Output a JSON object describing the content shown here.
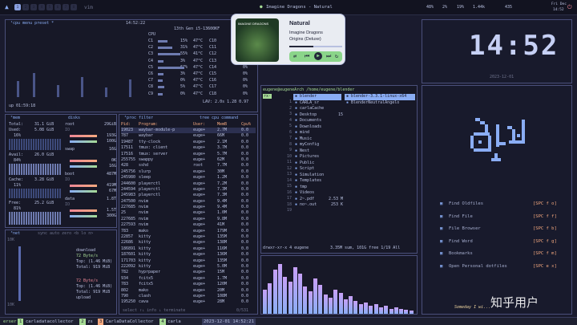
{
  "topbar": {
    "app": "vim",
    "media_title": "Imagine Dragons - Natural",
    "status": [
      "48%",
      "2%",
      "19%",
      "1.44k"
    ],
    "right": [
      "435",
      "Fri Dec",
      "14:52"
    ],
    "workspaces": [
      "1",
      "2",
      "3",
      "4",
      "5",
      "6",
      "7",
      "8"
    ]
  },
  "cpu": {
    "header": "¹cpu  menu  preset *",
    "time": "14:52:22",
    "model": "13th Gen i5-13600KF",
    "core_label": "CPU",
    "cores": [
      {
        "name": "C1",
        "pct": "15%",
        "temp": "47°C",
        "name2": "C10",
        "pct2": "0%"
      },
      {
        "name": "C2",
        "pct": "31%",
        "temp": "47°C",
        "name2": "C11",
        "pct2": "0%"
      },
      {
        "name": "C3",
        "pct": "55%",
        "temp": "41°C",
        "name2": "C12",
        "pct2": "0%"
      },
      {
        "name": "C4",
        "pct": "3%",
        "temp": "47°C",
        "name2": "C13",
        "pct2": "0%"
      },
      {
        "name": "C5",
        "pct": "67%",
        "temp": "47°C",
        "name2": "C14",
        "pct2": "0%"
      },
      {
        "name": "C6",
        "pct": "3%",
        "temp": "47°C",
        "name2": "C15",
        "pct2": "0%"
      },
      {
        "name": "C7",
        "pct": "0%",
        "temp": "47°C",
        "name2": "C16",
        "pct2": "0%"
      },
      {
        "name": "C8",
        "pct": "5%",
        "temp": "47°C",
        "name2": "C17",
        "pct2": "0%"
      },
      {
        "name": "C9",
        "pct": "0%",
        "temp": "47°C",
        "name2": "C18",
        "pct2": "0%"
      }
    ],
    "load": "LAV: 2.0s 1.28 0.97",
    "uptime": "up 01:59:18"
  },
  "mem": {
    "header": "²mem",
    "disks_header": "disks",
    "total_label": "Total:",
    "total": "31.1 GiB",
    "used_label": "Used:",
    "used": "5.08 GiB",
    "used_pct": "16%",
    "avail_label": "Avail:",
    "avail": "26.0 GiB",
    "avail_pct": "84%",
    "cache_label": "Cache:",
    "cache": "3.28 GiB",
    "cache_pct": "11%",
    "free_label": "Free:",
    "free": "25.2 GiB",
    "free_pct": "81%",
    "disks": [
      {
        "name": "root",
        "size": "29GiB",
        "io": "IO",
        "u": "193G",
        "f": "100G"
      },
      {
        "name": "swap",
        "size": "16G",
        "io": "",
        "u": "0K",
        "f": "16G"
      },
      {
        "name": "boot",
        "size": "487M",
        "io": "IO",
        "u": "419M",
        "f": "67M"
      },
      {
        "name": "data",
        "size": "1.8T",
        "io": "IO",
        "u": "1.5T",
        "f": "300G"
      }
    ]
  },
  "net": {
    "header": "³net",
    "tabs": "sync auto zero <b lo n>",
    "download_label": "download",
    "down_byte": "72 Byte/s",
    "down_top": "Top: (1.46 MiB)",
    "down_total": "Total: 919 MiB",
    "up_byte": "72 Byte/s",
    "up_top": "Top: (1.46 MiB)",
    "up_total": "Total: 919 MiB",
    "upload_label": "upload",
    "scale_top": "10K",
    "scale_bottom": "10K"
  },
  "proc": {
    "header": "⁴proc  filter",
    "tree": "tree  cpu  command",
    "columns": [
      "Pid:",
      "Program:",
      "User:",
      "MemB",
      "Cpu%"
    ],
    "rows": [
      [
        "19023",
        "waybar-module-p",
        "euge+",
        "2.7M",
        "0.0"
      ],
      [
        "787",
        "waybar",
        "euge+",
        "66M",
        "0.0"
      ],
      [
        "19487",
        "tty-clock",
        "euge+",
        "2.1M",
        "0.0"
      ],
      [
        "17511",
        "tmux: client",
        "euge+",
        "3.7M",
        "0.0"
      ],
      [
        "17516",
        "tmux: server",
        "euge+",
        "5.7M",
        "0.0"
      ],
      [
        "255755",
        "swappy",
        "euge+",
        "62M",
        "0.0"
      ],
      [
        "428",
        "sshd",
        "root",
        "7.7M",
        "0.0"
      ],
      [
        "245756",
        "slurp",
        "euge+",
        "30M",
        "0.0"
      ],
      [
        "245980",
        "sleep",
        "euge+",
        "1.2M",
        "0.0"
      ],
      [
        "244600",
        "playerctl",
        "euge+",
        "7.2M",
        "0.0"
      ],
      [
        "244594",
        "playerctl",
        "euge+",
        "7.3M",
        "0.0"
      ],
      [
        "245983",
        "playerctl",
        "euge+",
        "7.3M",
        "0.0"
      ],
      [
        "247500",
        "nvim",
        "euge+",
        "9.4M",
        "0.0"
      ],
      [
        "227685",
        "nvim",
        "euge+",
        "9.4M",
        "0.0"
      ],
      [
        "25",
        "nvim",
        "euge+",
        "1.0M",
        "0.0"
      ],
      [
        "227685",
        "nvim",
        "euge+",
        "9.8M",
        "0.0"
      ],
      [
        "227593",
        "nvim",
        "euge+",
        "41M",
        "0.0"
      ],
      [
        "783",
        "mako",
        "euge+",
        "179M",
        "0.0"
      ],
      [
        "22857",
        "kitty",
        "euge+",
        "135M",
        "0.0"
      ],
      [
        "22686",
        "kitty",
        "euge+",
        "138M",
        "0.0"
      ],
      [
        "186891",
        "kitty",
        "euge+",
        "116M",
        "0.0"
      ],
      [
        "187601",
        "kitty",
        "euge+",
        "136M",
        "0.0"
      ],
      [
        "171703",
        "kitty",
        "euge+",
        "135M",
        "0.0"
      ],
      [
        "222092",
        "kitty",
        "euge+",
        "5.0M",
        "0.0"
      ],
      [
        "782",
        "hyprpaper",
        "euge+",
        "15M",
        "0.0"
      ],
      [
        "934",
        "fcitx5",
        "euge+",
        "1.7M",
        "0.0"
      ],
      [
        "783",
        "fcitx5",
        "euge+",
        "120M",
        "0.0"
      ],
      [
        "802",
        "mako",
        "euge+",
        "20M",
        "0.0"
      ],
      [
        "790",
        "clash",
        "euge+",
        "108M",
        "0.0"
      ],
      [
        "195250",
        "cava",
        "euge+",
        "28M",
        "0.0"
      ]
    ],
    "footer": "select ↑↓ info ↓ terminate",
    "count": "0/531"
  },
  "music": {
    "title": "Natural",
    "artist": "Imagine Dragons",
    "album": "Origins (Deluxe)",
    "cover_text": "IMAGINE DRAGONS"
  },
  "files": {
    "path": "eugene@eugeneArch  /home/eugene/blender",
    "tab": "rx·",
    "col1": [
      "blender",
      "CARLA_sr",
      "carlaCache",
      "Desktop",
      "Documents",
      "Downloads",
      "mind",
      "Music",
      "myConfig",
      "Nest",
      "Pictures",
      "Public",
      "Script",
      "Simulation",
      "Templates",
      "tmp",
      "Videos",
      "2~.pdf",
      "no~.out"
    ],
    "col1_num": [
      "",
      "",
      "",
      "15",
      "",
      "",
      "",
      "",
      "",
      "",
      "",
      "",
      "",
      "",
      "",
      "",
      "",
      "2.53 M",
      "253 K"
    ],
    "col2": [
      "blender-3.3.1-linux-x64",
      "BlenderNeutralAngelo"
    ],
    "line_nums": [
      "1",
      "2",
      "3",
      "4",
      "5",
      "6",
      "7",
      "8",
      "9",
      "10",
      "11",
      "12",
      "13",
      "14",
      "15",
      "16",
      "17",
      "18",
      "19"
    ],
    "status": "drwxr-xr-x 4 eugene",
    "status_right": "3.35M sum, 101G free  1/19  All"
  },
  "clock": {
    "time": "14:52",
    "date": "2023-12-01",
    "footer": "Someday I wi..."
  },
  "dashboard": {
    "items": [
      {
        "label": "Find Oldfiles",
        "key": "[SPC f o]"
      },
      {
        "label": "Find File",
        "key": "[SPC f f]"
      },
      {
        "label": "File Browser",
        "key": "[SPC f b]"
      },
      {
        "label": "Find Word",
        "key": "[SPC f g]"
      },
      {
        "label": "Bookmarks",
        "key": "[SPC f m]"
      },
      {
        "label": "Open Personal dotfiles",
        "key": "[SPC e x]"
      }
    ]
  },
  "tmux": {
    "session": "erser",
    "windows": [
      {
        "idx": "1",
        "name": "carladatacollector"
      },
      {
        "idx": "2",
        "name": "zs"
      },
      {
        "idx": "3",
        "name": "CarlaDataCollector"
      },
      {
        "idx": "4",
        "name": "carla"
      }
    ],
    "datetime": "2023-12-01 14:52:21"
  },
  "watermark": "知乎用户",
  "colors": {
    "accent": "#8aadf4",
    "bg": "#1a1b2e",
    "border": "#4a4f7a"
  }
}
